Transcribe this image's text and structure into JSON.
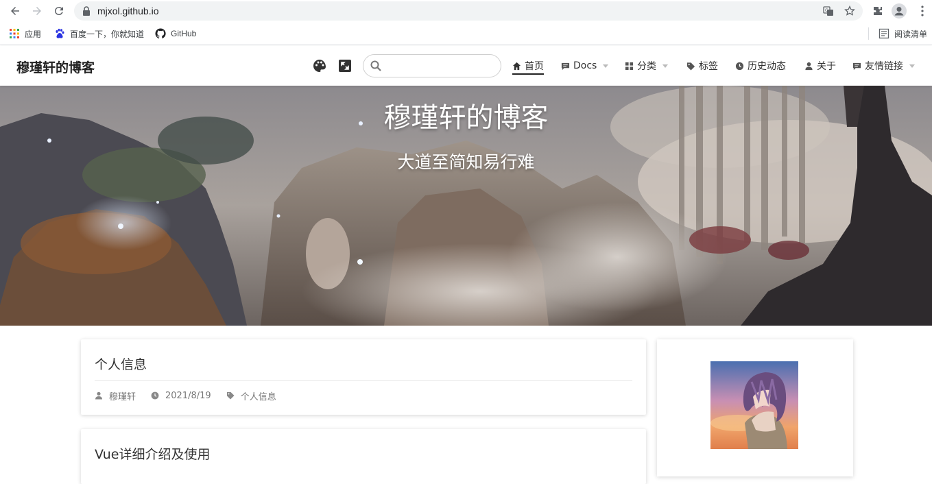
{
  "browser": {
    "url": "mjxol.github.io",
    "bookmarks": [
      {
        "label": "应用"
      },
      {
        "label": "百度一下，你就知道"
      },
      {
        "label": "GitHub"
      }
    ],
    "reading_list_label": "阅读清单"
  },
  "header": {
    "site_title": "穆瑾轩的博客",
    "search_placeholder": "",
    "menu": [
      {
        "label": "首页",
        "icon": "home-icon",
        "active": true
      },
      {
        "label": "Docs",
        "icon": "comment-icon",
        "dropdown": true
      },
      {
        "label": "分类",
        "icon": "grid-icon",
        "dropdown": true
      },
      {
        "label": "标签",
        "icon": "tag-icon"
      },
      {
        "label": "历史动态",
        "icon": "clock-icon"
      },
      {
        "label": "关于",
        "icon": "user-icon"
      },
      {
        "label": "友情链接",
        "icon": "comment-icon",
        "dropdown": true
      }
    ]
  },
  "banner": {
    "title": "穆瑾轩的博客",
    "subtitle": "大道至简知易行难"
  },
  "posts": [
    {
      "title": "个人信息",
      "author": "穆瑾轩",
      "date": "2021/8/19",
      "category": "个人信息"
    },
    {
      "title": "Vue详细介绍及使用"
    }
  ],
  "colors": {
    "accent": "#222222",
    "meta_text": "#777777"
  }
}
